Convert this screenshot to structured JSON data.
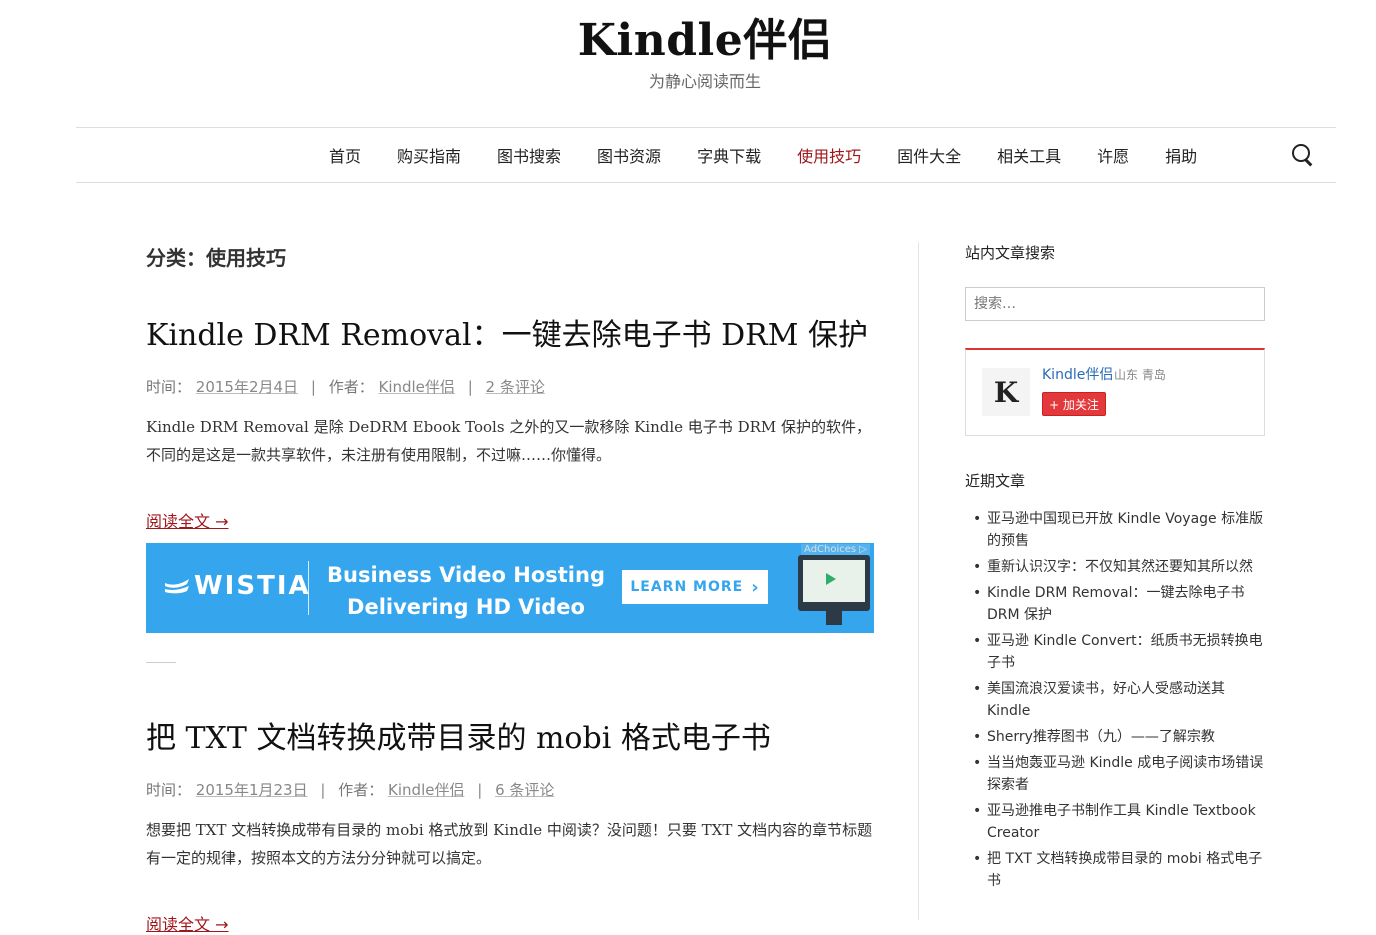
{
  "site": {
    "title": "Kindle伴侣",
    "tagline": "为静心阅读而生"
  },
  "nav": {
    "items": [
      "首页",
      "购买指南",
      "图书搜索",
      "图书资源",
      "字典下载",
      "使用技巧",
      "固件大全",
      "相关工具",
      "许愿",
      "捐助"
    ],
    "active": "使用技巧"
  },
  "archive": {
    "title": "分类：使用技巧"
  },
  "posts": [
    {
      "title": "Kindle DRM Removal：一键去除电子书 DRM 保护",
      "meta": {
        "date_label": "时间：",
        "date": "2015年2月4日",
        "author_label": "作者：",
        "author": "Kindle伴侣",
        "comments": "2 条评论"
      },
      "excerpt": "Kindle DRM Removal 是除 DeDRM Ebook Tools 之外的又一款移除 Kindle 电子书 DRM 保护的软件，不同的是这是一款共享软件，未注册有使用限制，不过嘛……你懂得。",
      "read_more": "阅读全文 →"
    },
    {
      "title": "把 TXT 文档转换成带目录的 mobi 格式电子书",
      "meta": {
        "date_label": "时间：",
        "date": "2015年1月23日",
        "author_label": "作者：",
        "author": "Kindle伴侣",
        "comments": "6 条评论"
      },
      "excerpt": "想要把 TXT 文档转换成带有目录的 mobi 格式放到 Kindle 中阅读？没问题！只要 TXT 文档内容的章节标题有一定的规律，按照本文的方法分分钟就可以搞定。",
      "read_more": "阅读全文 →"
    }
  ],
  "ad": {
    "brand": "WISTIA",
    "headline_1": "Business Video Hosting",
    "headline_2": "Delivering HD Video",
    "button": "LEARN MORE",
    "button_arrow": "›",
    "adchoices": "AdChoices ▷",
    "bg_color": "#35a6ee"
  },
  "sidebar": {
    "search_title": "站内文章搜索",
    "search_placeholder": "搜索…",
    "weibo": {
      "avatar_letter": "K",
      "name": "Kindle伴侣",
      "location": "山东 青岛",
      "follow": "+ 加关注"
    },
    "recent_title": "近期文章",
    "recent_posts": [
      "亚马逊中国现已开放 Kindle Voyage 标准版的预售",
      "重新认识汉字：不仅知其然还要知其所以然",
      "Kindle DRM Removal：一键去除电子书 DRM 保护",
      "亚马逊 Kindle Convert：纸质书无损转换电子书",
      "美国流浪汉爱读书，好心人受感动送其 Kindle",
      "Sherry推荐图书（九）——了解宗教",
      "当当炮轰亚马逊 Kindle 成电子阅读市场错误探索者",
      "亚马逊推电子书制作工具 Kindle Textbook Creator",
      "把 TXT 文档转换成带目录的 mobi 格式电子书"
    ]
  },
  "colors": {
    "accent": "#a0161a",
    "link_blue": "#2a6bb7",
    "follow_red": "#e4393c"
  }
}
